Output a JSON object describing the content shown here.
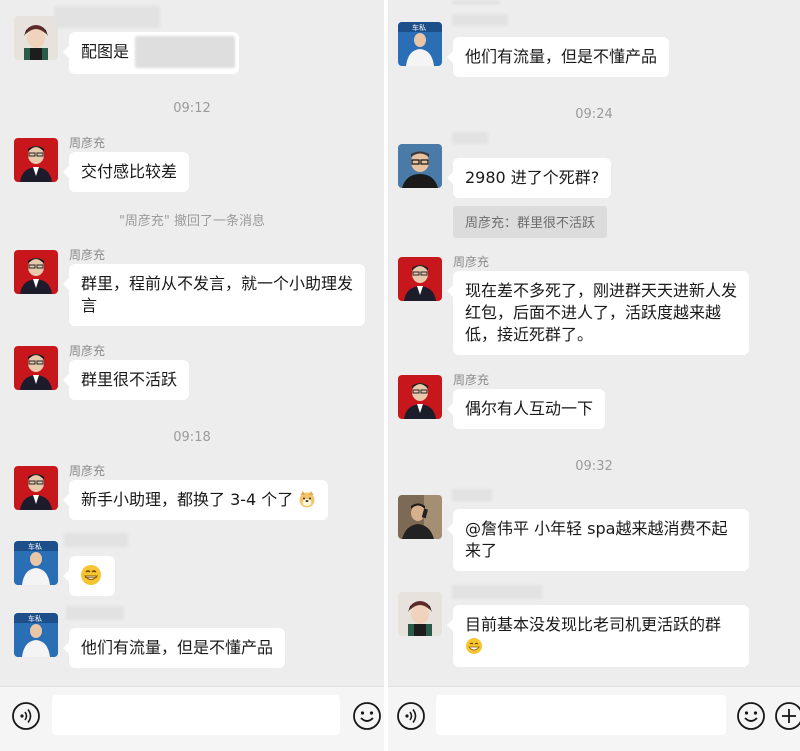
{
  "left": {
    "top_message": {
      "text": "配图是"
    },
    "time_1": "09:12",
    "msg_1": {
      "sender": "周彦充",
      "text": "交付感比较差"
    },
    "recall_notice": "\"周彦充\" 撤回了一条消息",
    "msg_2": {
      "sender": "周彦充",
      "text": "群里，程前从不发言，就一个小助理发言"
    },
    "msg_3": {
      "sender": "周彦充",
      "text": "群里很不活跃"
    },
    "time_2": "09:18",
    "msg_4": {
      "sender": "周彦充",
      "text": "新手小助理，都换了 3-4 个了"
    },
    "msg_5": {
      "emoji": "grin-emoji"
    },
    "msg_6": {
      "text": "他们有流量，但是不懂产品"
    }
  },
  "right": {
    "msg_1": {
      "text": "他们有流量，但是不懂产品"
    },
    "time_1": "09:24",
    "msg_2": {
      "text": "2980 进了个死群?",
      "quote": "周彦充：群里很不活跃"
    },
    "msg_3": {
      "sender": "周彦充",
      "text": "现在差不多死了，刚进群天天进新人发红包，后面不进人了，活跃度越来越低，接近死群了。"
    },
    "msg_4": {
      "sender": "周彦充",
      "text": "偶尔有人互动一下"
    },
    "time_2": "09:32",
    "msg_5": {
      "text": "@詹伟平 小年轻 spa越来越消费不起来了"
    },
    "msg_6": {
      "text": "目前基本没发现比老司机更活跃的群"
    }
  },
  "colors": {
    "background": "#ededed",
    "bubble": "#ffffff",
    "timestamp": "#9b9b9b"
  }
}
